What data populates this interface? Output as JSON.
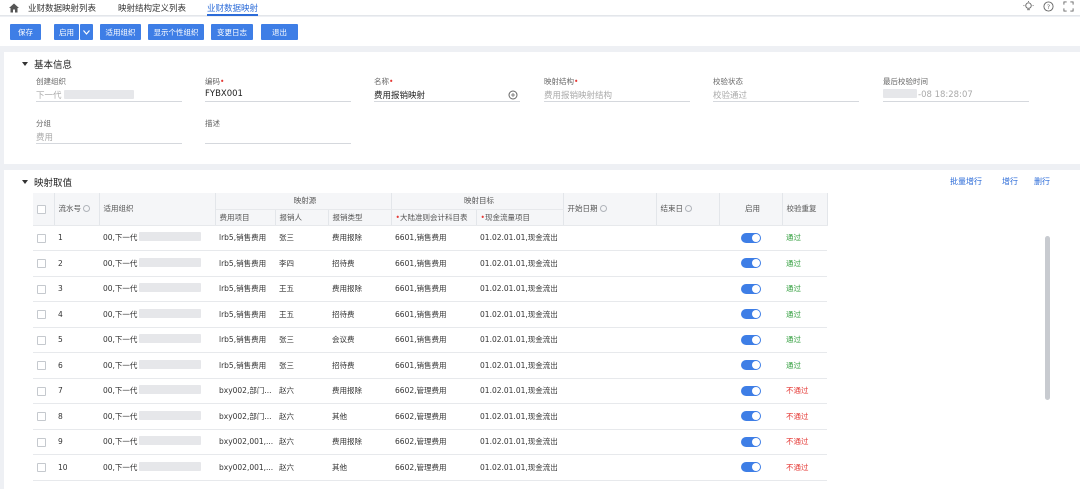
{
  "tabs": [
    "业财数据映射列表",
    "映射结构定义列表",
    "业财数据映射"
  ],
  "toolbar": {
    "save": "保存",
    "enable": "启用",
    "apply_org": "适用组织",
    "show_personal_org": "显示个性组织",
    "change_log": "变更日志",
    "exit": "退出"
  },
  "basic": {
    "title": "基本信息",
    "create_org_label": "创建组织",
    "create_org_value": "下一代",
    "code_label": "编码",
    "code_value": "FYBX001",
    "name_label": "名称",
    "name_value": "费用报销映射",
    "structure_label": "映射结构",
    "structure_placeholder": "费用报销映射结构",
    "check_status_label": "校验状态",
    "check_status_value": "校验通过",
    "last_check_label": "最后校验时间",
    "last_check_value": "-08 18:28:07",
    "group_label": "分组",
    "group_value": "费用",
    "desc_label": "描述",
    "desc_value": ""
  },
  "mapping": {
    "title": "映射取值",
    "actions": {
      "batch_add": "批量增行",
      "add": "增行",
      "delete": "删行"
    },
    "headers": {
      "seq": "流水号",
      "org": "适用组织",
      "source_group": "映射源",
      "target_group": "映射目标",
      "expense_item": "费用项目",
      "claimant": "报销人",
      "claim_type": "报销类型",
      "account": "大陆准则会计科目表",
      "cashflow": "现金流量项目",
      "start_date": "开始日期",
      "end_date": "结束日",
      "enabled": "启用",
      "check_repeat": "校验重复"
    },
    "rows": [
      {
        "seq": "1",
        "org": "00,下一代",
        "item": "lrb5,销售费用",
        "person": "张三",
        "type": "费用报除",
        "account": "6601,销售费用",
        "cash": "01.02.01.01,现金流出",
        "status": "通过",
        "ok": true
      },
      {
        "seq": "2",
        "org": "00,下一代",
        "item": "lrb5,销售费用",
        "person": "李四",
        "type": "招待费",
        "account": "6601,销售费用",
        "cash": "01.02.01.01,现金流出",
        "status": "通过",
        "ok": true
      },
      {
        "seq": "3",
        "org": "00,下一代",
        "item": "lrb5,销售费用",
        "person": "王五",
        "type": "费用报除",
        "account": "6601,销售费用",
        "cash": "01.02.01.01,现金流出",
        "status": "通过",
        "ok": true
      },
      {
        "seq": "4",
        "org": "00,下一代",
        "item": "lrb5,销售费用",
        "person": "王五",
        "type": "招待费",
        "account": "6601,销售费用",
        "cash": "01.02.01.01,现金流出",
        "status": "通过",
        "ok": true
      },
      {
        "seq": "5",
        "org": "00,下一代",
        "item": "lrb5,销售费用",
        "person": "张三",
        "type": "会议费",
        "account": "6601,销售费用",
        "cash": "01.02.01.01,现金流出",
        "status": "通过",
        "ok": true
      },
      {
        "seq": "6",
        "org": "00,下一代",
        "item": "lrb5,销售费用",
        "person": "张三",
        "type": "招待费",
        "account": "6601,销售费用",
        "cash": "01.02.01.01,现金流出",
        "status": "通过",
        "ok": true
      },
      {
        "seq": "7",
        "org": "00,下一代",
        "item": "bxy002,部门...",
        "person": "赵六",
        "type": "费用报除",
        "account": "6602,管理费用",
        "cash": "01.02.01.01,现金流出",
        "status": "不通过",
        "ok": false
      },
      {
        "seq": "8",
        "org": "00,下一代",
        "item": "bxy002,部门...",
        "person": "赵六",
        "type": "其他",
        "account": "6602,管理费用",
        "cash": "01.02.01.01,现金流出",
        "status": "不通过",
        "ok": false
      },
      {
        "seq": "9",
        "org": "00,下一代",
        "item": "bxy002,001,...",
        "person": "赵六",
        "type": "费用报除",
        "account": "6602,管理费用",
        "cash": "01.02.01.01,现金流出",
        "status": "不通过",
        "ok": false
      },
      {
        "seq": "10",
        "org": "00,下一代",
        "item": "bxy002,001,...",
        "person": "赵六",
        "type": "其他",
        "account": "6602,管理费用",
        "cash": "01.02.01.01,现金流出",
        "status": "不通过",
        "ok": false
      }
    ]
  },
  "colors": {
    "accent": "#3e7ee6",
    "pass": "#2e9d3a",
    "fail": "#e53935"
  }
}
